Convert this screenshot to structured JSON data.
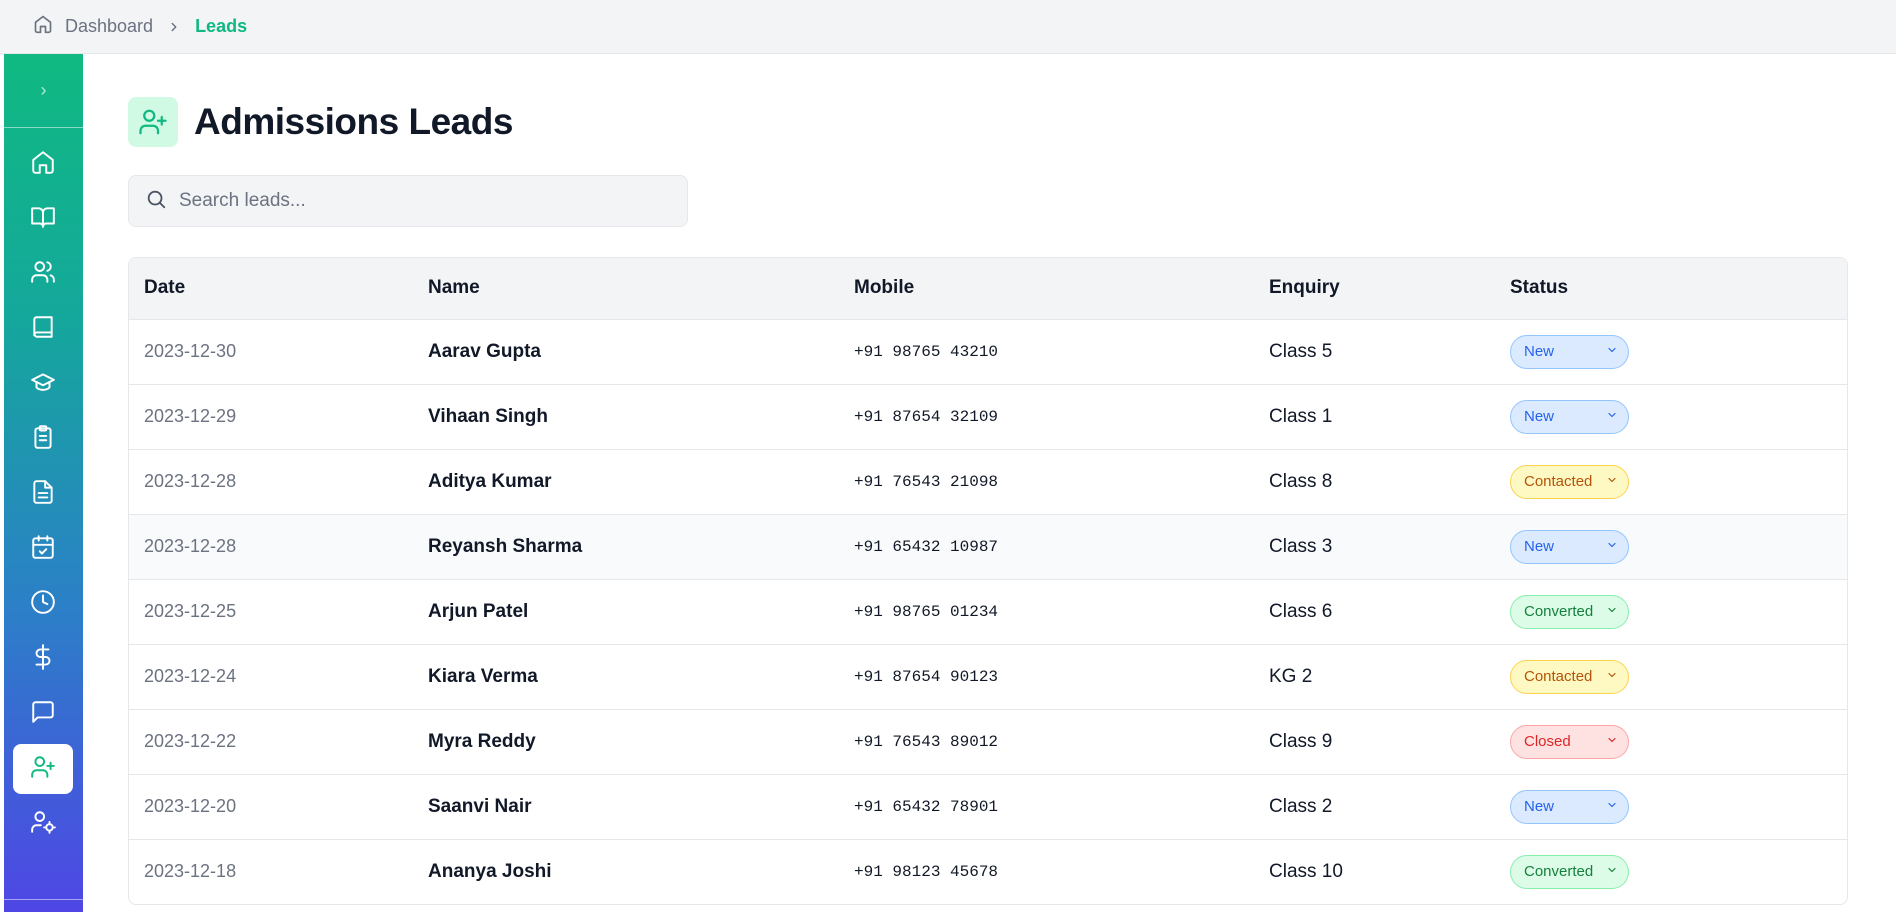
{
  "breadcrumb": {
    "home": "Dashboard",
    "current": "Leads"
  },
  "page": {
    "title": "Admissions Leads"
  },
  "search": {
    "placeholder": "Search leads..."
  },
  "table": {
    "headers": {
      "date": "Date",
      "name": "Name",
      "mobile": "Mobile",
      "enquiry": "Enquiry",
      "status": "Status"
    },
    "rows": [
      {
        "date": "2023-12-30",
        "name": "Aarav Gupta",
        "mobile": "+91 98765 43210",
        "enquiry": "Class 5",
        "status": "New"
      },
      {
        "date": "2023-12-29",
        "name": "Vihaan Singh",
        "mobile": "+91 87654 32109",
        "enquiry": "Class 1",
        "status": "New"
      },
      {
        "date": "2023-12-28",
        "name": "Aditya Kumar",
        "mobile": "+91 76543 21098",
        "enquiry": "Class 8",
        "status": "Contacted"
      },
      {
        "date": "2023-12-28",
        "name": "Reyansh Sharma",
        "mobile": "+91 65432 10987",
        "enquiry": "Class 3",
        "status": "New"
      },
      {
        "date": "2023-12-25",
        "name": "Arjun Patel",
        "mobile": "+91 98765 01234",
        "enquiry": "Class 6",
        "status": "Converted"
      },
      {
        "date": "2023-12-24",
        "name": "Kiara Verma",
        "mobile": "+91 87654 90123",
        "enquiry": "KG 2",
        "status": "Contacted"
      },
      {
        "date": "2023-12-22",
        "name": "Myra Reddy",
        "mobile": "+91 76543 89012",
        "enquiry": "Class 9",
        "status": "Closed"
      },
      {
        "date": "2023-12-20",
        "name": "Saanvi Nair",
        "mobile": "+91 65432 78901",
        "enquiry": "Class 2",
        "status": "New"
      },
      {
        "date": "2023-12-18",
        "name": "Ananya Joshi",
        "mobile": "+91 98123 45678",
        "enquiry": "Class 10",
        "status": "Converted"
      }
    ]
  },
  "sidebar": {
    "items": [
      {
        "icon": "home-icon"
      },
      {
        "icon": "book-open-icon"
      },
      {
        "icon": "users-icon"
      },
      {
        "icon": "book-icon"
      },
      {
        "icon": "graduation-cap-icon"
      },
      {
        "icon": "clipboard-list-icon"
      },
      {
        "icon": "file-text-icon"
      },
      {
        "icon": "calendar-check-icon"
      },
      {
        "icon": "clock-icon"
      },
      {
        "icon": "dollar-icon"
      },
      {
        "icon": "message-icon"
      },
      {
        "icon": "user-plus-icon",
        "active": true
      },
      {
        "icon": "user-cog-icon"
      }
    ]
  },
  "colors": {
    "accent": "#10b981",
    "new": "#2563eb",
    "contacted": "#b45309",
    "converted": "#15803d",
    "closed": "#dc2626"
  }
}
